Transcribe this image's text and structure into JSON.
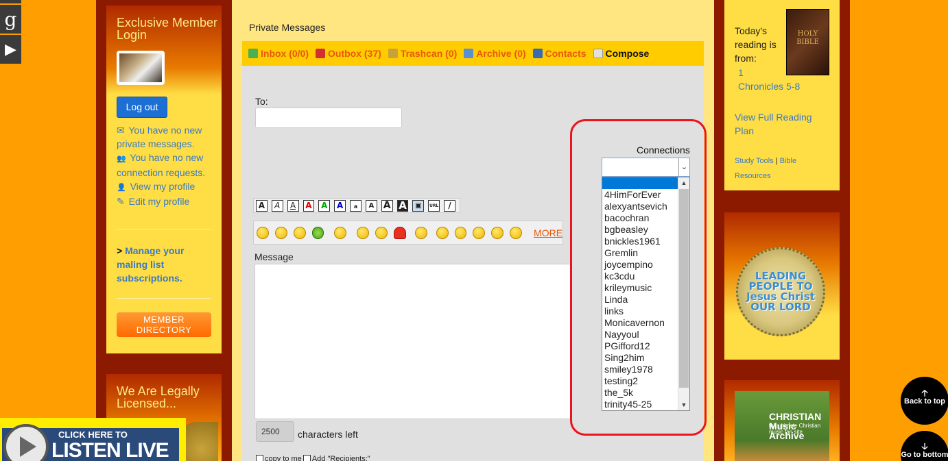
{
  "social": {
    "items": [
      "g",
      "▶"
    ]
  },
  "left_panel": {
    "title": "Exclusive Member Login",
    "logout_label": "Log out",
    "links": [
      {
        "icon": "envelope-icon",
        "glyph": "✉",
        "text": "You have no new private messages."
      },
      {
        "icon": "users-icon",
        "glyph": "👥",
        "text": "You have no new connection requests."
      },
      {
        "icon": "user-icon",
        "glyph": "👤",
        "text": "View my profile"
      },
      {
        "icon": "pencil-icon",
        "glyph": "✎",
        "text": "Edit my profile"
      }
    ],
    "manage_prefix": ">",
    "manage_text": "Manage your maling list subscriptions.",
    "member_directory_line1": "MEMBER",
    "member_directory_line2": "DIRECTORY",
    "licensed_title": "We Are Legally Licensed..."
  },
  "listen_live": {
    "line1": "CLICK HERE TO",
    "line2": "LISTEN LIVE"
  },
  "messages": {
    "page_title": "Private Messages",
    "tabs": [
      {
        "label": "Inbox (0/0)",
        "color": "#4caf50"
      },
      {
        "label": "Outbox (37)",
        "color": "#d32f2f"
      },
      {
        "label": "Trashcan (0)",
        "color": "#c9a13a"
      },
      {
        "label": "Archive (0)",
        "color": "#5b8fd4"
      },
      {
        "label": "Contacts",
        "color": "#3a6ab0"
      },
      {
        "label": "Compose",
        "color": "#e0e0e0"
      }
    ],
    "to_label": "To:",
    "to_value": "",
    "format_buttons": [
      "A",
      "A",
      "A",
      "A",
      "A",
      "A",
      "a",
      "A",
      "A",
      "A",
      "▣",
      "URL",
      "/"
    ],
    "smiley_count": 14,
    "more_label": "MORE",
    "message_label": "Message",
    "message_value": "",
    "chars_left_value": "2500",
    "chars_left_label": "characters left",
    "copy_to_me_label": "copy to me",
    "add_recipients_label": "Add \"Recipients:\""
  },
  "connections": {
    "label": "Connections",
    "selected": "",
    "options": [
      "4HimForEver",
      "alexyantsevich",
      "bacochran",
      "bgbeasley",
      "bnickles1961",
      "Gremlin",
      "joycempino",
      "kc3cdu",
      "krileymusic",
      "Linda",
      "links",
      "Monicavernon",
      "Nayyoul",
      "PGifford12",
      "Sing2him",
      "smiley1978",
      "testing2",
      "the_5k",
      "trinity45-25"
    ]
  },
  "reading_plan": {
    "intro": "Today's reading is from:",
    "bible_text": "HOLY BIBLE",
    "reference_line1": "1",
    "reference_line2": "Chronicles 5-8",
    "full_plan": "View Full Reading Plan",
    "study_tools": "Study Tools",
    "separator": "|",
    "bible_resources": "Bible Resources"
  },
  "badge": {
    "text": "LEADING PEOPLE TO Jesus Christ OUR LORD"
  },
  "christian_music": {
    "title": "CHRISTIAN Music Archive",
    "subtitle": "the ultimate Christian music fan site"
  },
  "floating": {
    "back_to_top": "Back to top",
    "go_to_bottom": "Go to bottom"
  }
}
